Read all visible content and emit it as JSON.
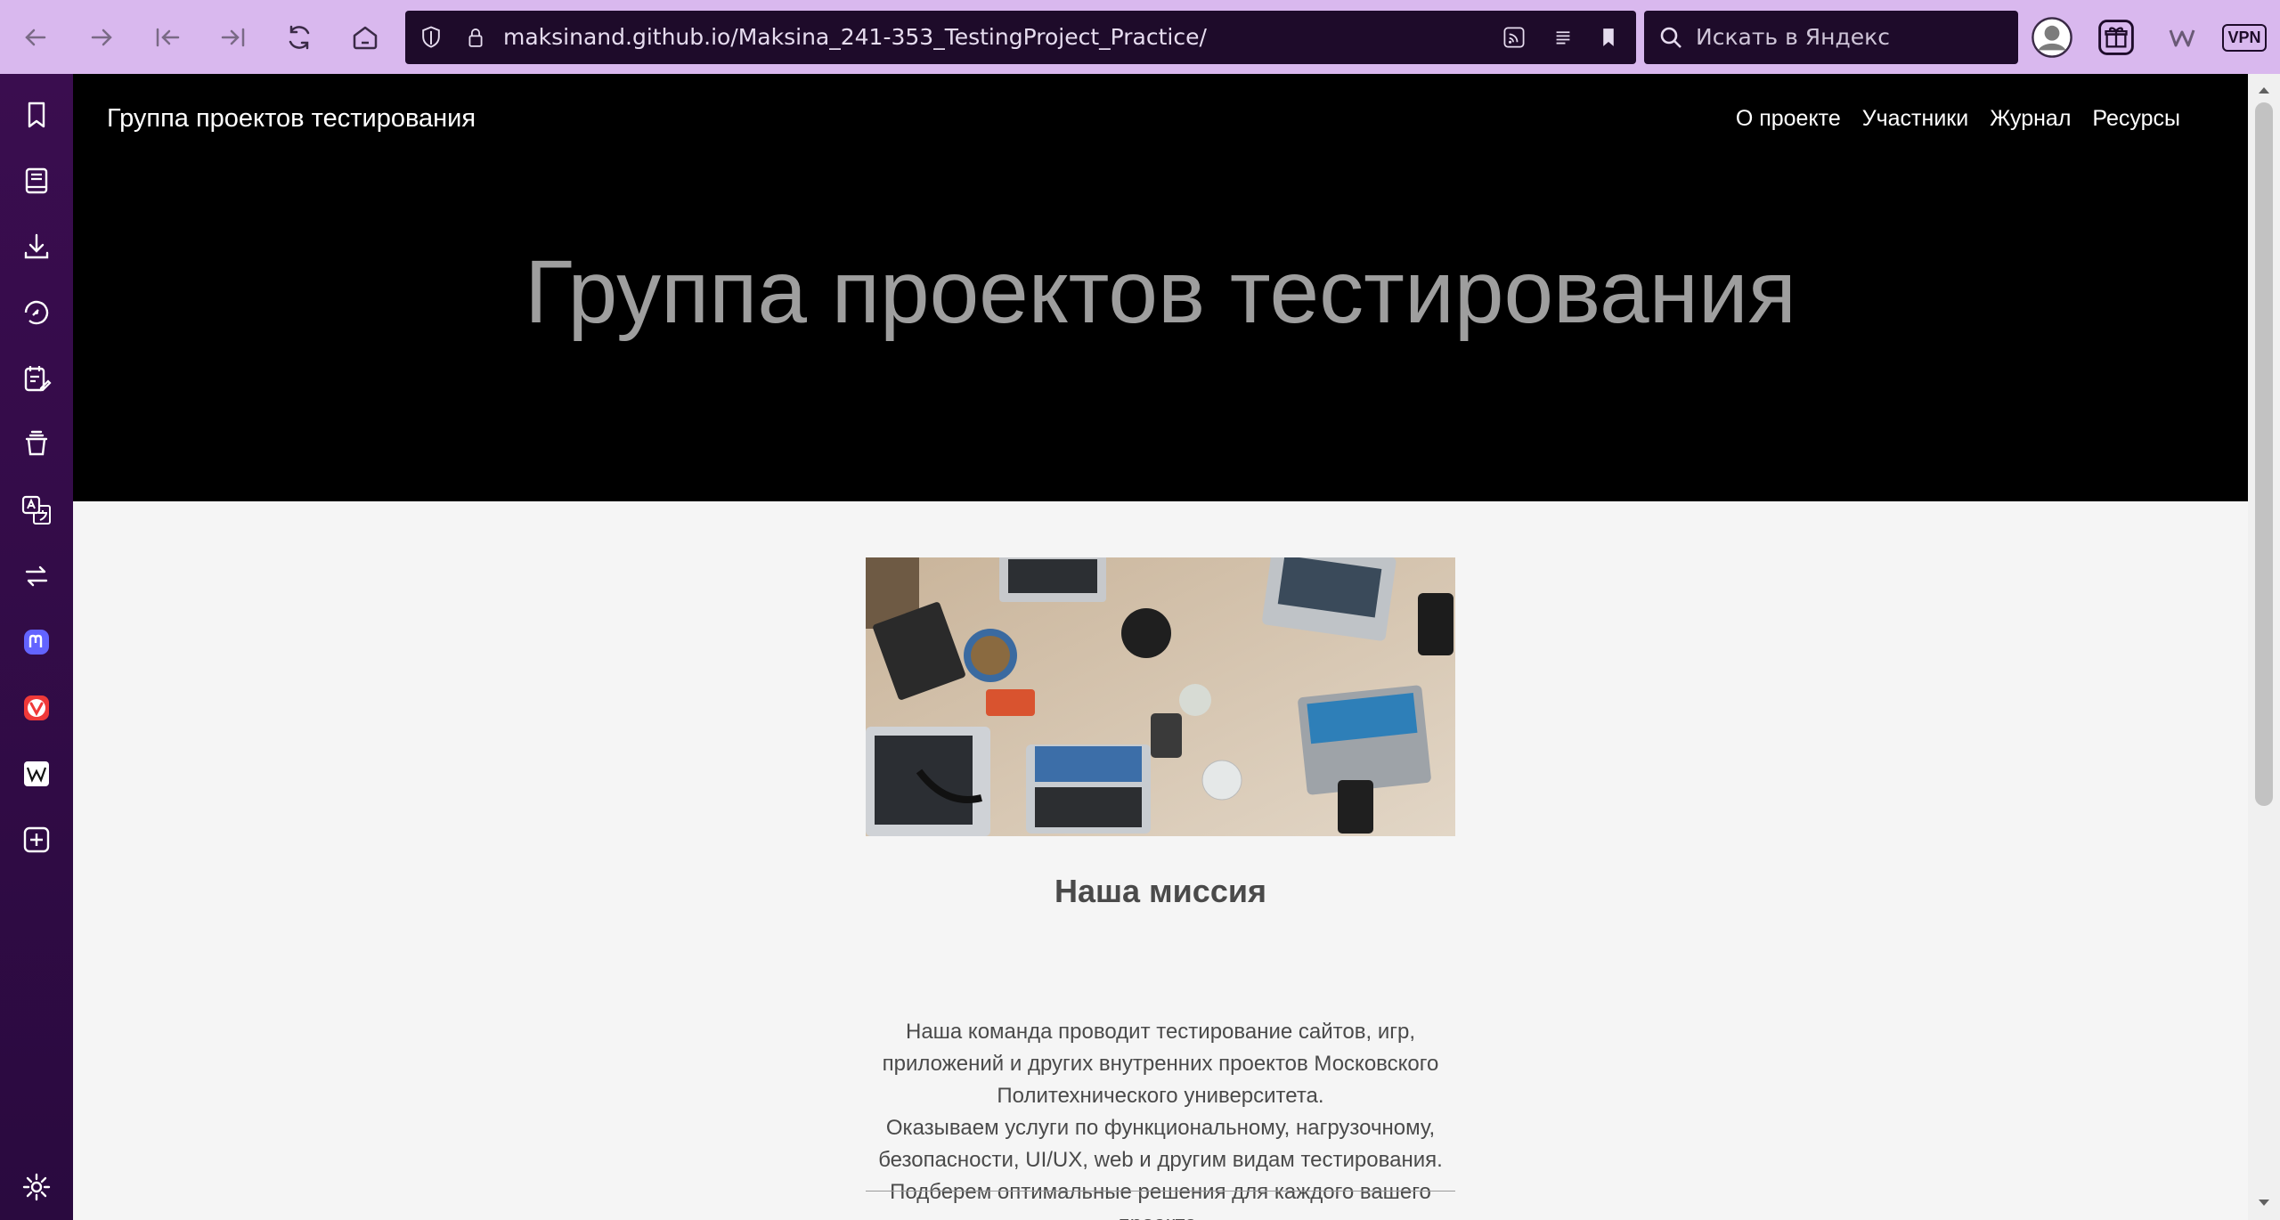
{
  "browser": {
    "url": "maksinand.github.io/Maksina_241-353_TestingProject_Practice/",
    "search_placeholder": "Искать в Яндекс",
    "vpn_label": "VPN",
    "accent": "#d9b8ee"
  },
  "site": {
    "brand": "Группа проектов тестирования",
    "nav": [
      "О проекте",
      "Участники",
      "Журнал",
      "Ресурсы"
    ],
    "hero_title": "Группа проектов тестирования"
  },
  "mission": {
    "title": "Наша миссия",
    "lines": [
      "Наша команда проводит тестирование сайтов, игр,",
      "приложений и других внутренних проектов Московского",
      "Политехнического университета.",
      "Оказываем услуги по функциональному, нагрузочному,",
      "безопасности, UI/UX, web и другим видам тестирования.",
      "Подберем оптимальные решения для каждого вашего",
      "проекта."
    ]
  }
}
